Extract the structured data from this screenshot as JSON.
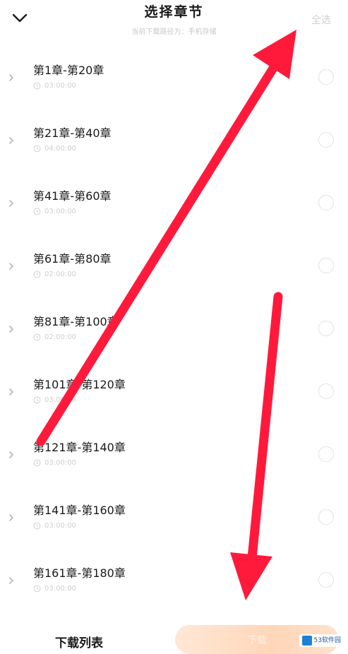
{
  "header": {
    "title": "选择章节",
    "subtitle": "当前下载路径为：手机存储",
    "select_all": "全选"
  },
  "chapters": [
    {
      "label": "第1章-第20章",
      "duration": "03:00:00"
    },
    {
      "label": "第21章-第40章",
      "duration": "04:00:00"
    },
    {
      "label": "第41章-第60章",
      "duration": "03:00:00"
    },
    {
      "label": "第61章-第80章",
      "duration": "02:00:00"
    },
    {
      "label": "第81章-第100章",
      "duration": "02:00:00"
    },
    {
      "label": "第101章-第120章",
      "duration": "03:00:00"
    },
    {
      "label": "第121章-第140章",
      "duration": "03:00:00"
    },
    {
      "label": "第141章-第160章",
      "duration": "03:00:00"
    },
    {
      "label": "第161章-第180章",
      "duration": "03:00:00"
    }
  ],
  "footer": {
    "download_list": "下载列表",
    "download_button": "下载"
  },
  "watermark": {
    "line1": "53软件园"
  },
  "colors": {
    "arrow": "#ff1a3c",
    "download_gradient_start": "#ffe8d6",
    "download_gradient_end": "#ffd6b8"
  }
}
